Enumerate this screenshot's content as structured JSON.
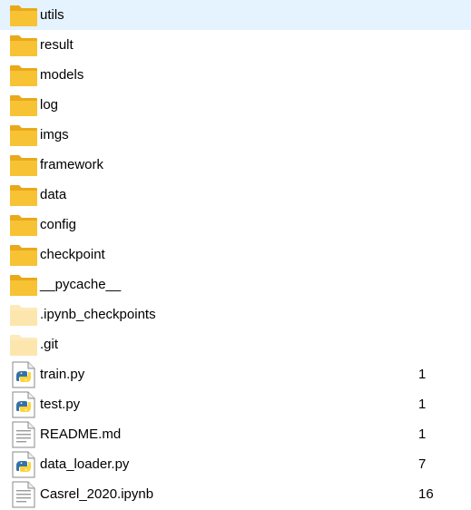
{
  "colors": {
    "folder": "#f8c235",
    "folder_back": "#e9a91a",
    "hidden_folder": "#fde6ae",
    "python_blue": "#3572a5",
    "python_yellow": "#ffd43b"
  },
  "items": [
    {
      "name": "utils",
      "type": "folder",
      "icon": "folder-icon",
      "size": ""
    },
    {
      "name": "result",
      "type": "folder",
      "icon": "folder-icon",
      "size": ""
    },
    {
      "name": "models",
      "type": "folder",
      "icon": "folder-icon",
      "size": ""
    },
    {
      "name": "log",
      "type": "folder",
      "icon": "folder-icon",
      "size": ""
    },
    {
      "name": "imgs",
      "type": "folder",
      "icon": "folder-icon",
      "size": ""
    },
    {
      "name": "framework",
      "type": "folder",
      "icon": "folder-icon",
      "size": ""
    },
    {
      "name": "data",
      "type": "folder",
      "icon": "folder-icon",
      "size": ""
    },
    {
      "name": "config",
      "type": "folder",
      "icon": "folder-icon",
      "size": ""
    },
    {
      "name": "checkpoint",
      "type": "folder",
      "icon": "folder-icon",
      "size": ""
    },
    {
      "name": "__pycache__",
      "type": "folder",
      "icon": "folder-icon",
      "size": ""
    },
    {
      "name": ".ipynb_checkpoints",
      "type": "hidden-folder",
      "icon": "hidden-folder-icon",
      "size": ""
    },
    {
      "name": ".git",
      "type": "hidden-folder",
      "icon": "hidden-folder-icon",
      "size": ""
    },
    {
      "name": "train.py",
      "type": "python",
      "icon": "python-file-icon",
      "size": "1"
    },
    {
      "name": "test.py",
      "type": "python",
      "icon": "python-file-icon",
      "size": "1"
    },
    {
      "name": "README.md",
      "type": "text",
      "icon": "text-file-icon",
      "size": "1"
    },
    {
      "name": "data_loader.py",
      "type": "python",
      "icon": "python-file-icon",
      "size": "7"
    },
    {
      "name": "Casrel_2020.ipynb",
      "type": "text",
      "icon": "text-file-icon",
      "size": "16"
    }
  ]
}
